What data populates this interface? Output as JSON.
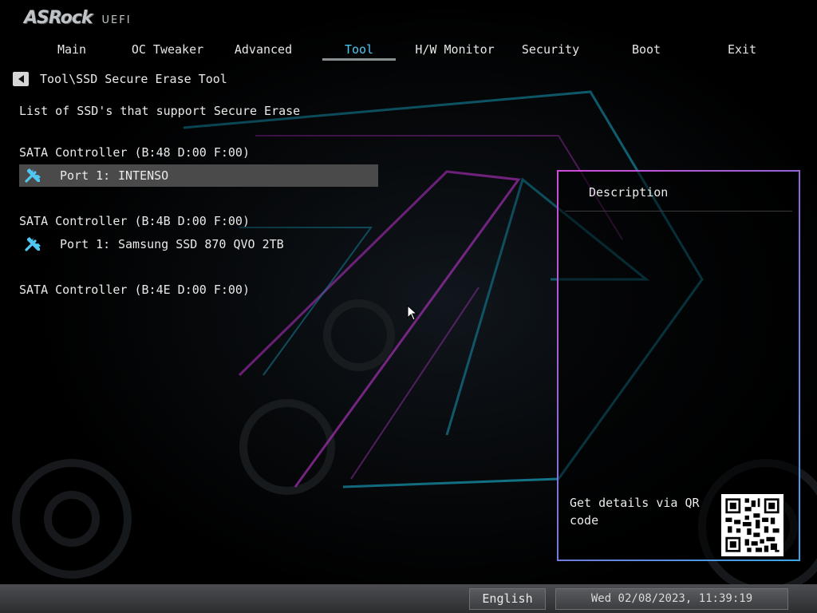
{
  "branding": {
    "brand": "ASRock",
    "product": "UEFI"
  },
  "tabs": [
    {
      "label": "Main"
    },
    {
      "label": "OC Tweaker"
    },
    {
      "label": "Advanced"
    },
    {
      "label": "Tool",
      "active": true
    },
    {
      "label": "H/W Monitor"
    },
    {
      "label": "Security"
    },
    {
      "label": "Boot"
    },
    {
      "label": "Exit"
    }
  ],
  "breadcrumb": {
    "path": "Tool\\SSD Secure Erase Tool"
  },
  "content": {
    "subtitle": "List of SSD's that support Secure Erase",
    "controllers": [
      {
        "label": "SATA Controller (B:48 D:00 F:00)",
        "ports": [
          {
            "port": "Port 1:",
            "device": "INTENSO",
            "selected": true
          }
        ]
      },
      {
        "label": "SATA Controller (B:4B D:00 F:00)",
        "ports": [
          {
            "port": "Port 1:",
            "device": "Samsung SSD 870 QVO 2TB",
            "selected": false
          }
        ]
      },
      {
        "label": "SATA Controller (B:4E D:00 F:00)",
        "ports": []
      }
    ]
  },
  "description_panel": {
    "title": "Description",
    "qr_text": "Get details via QR code"
  },
  "footer": {
    "language": "English",
    "datetime": "Wed 02/08/2023, 11:39:19"
  },
  "colors": {
    "active_tab": "#4fc7f0",
    "tool_icon": "#4fc7f0",
    "selected_row": "#4a4a4a",
    "panel_border_start": "#d04ad8",
    "panel_border_end": "#3aa6e8"
  }
}
